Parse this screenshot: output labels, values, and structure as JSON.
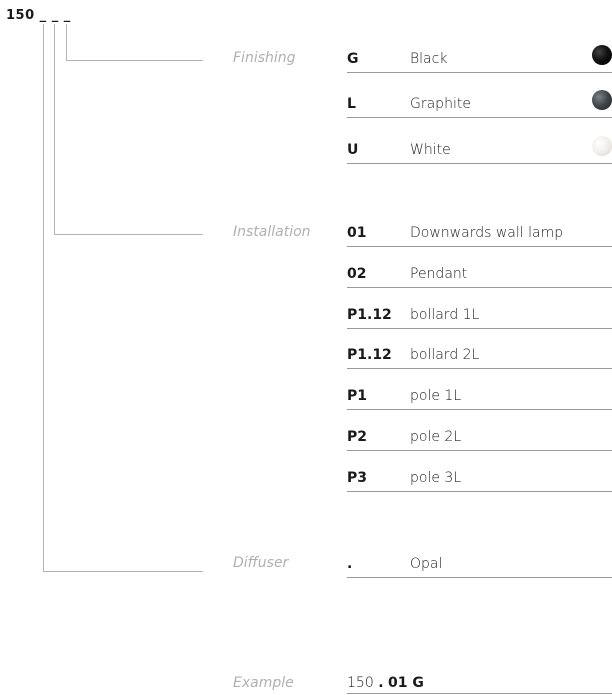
{
  "code_header": "150 _ _ _",
  "finishing": {
    "label": "Finishing",
    "options": [
      {
        "code": "G",
        "name": "Black",
        "swatch": "black-icon",
        "color": "#111111"
      },
      {
        "code": "L",
        "name": "Graphite",
        "swatch": "graphite-icon",
        "color": "#3e4446"
      },
      {
        "code": "U",
        "name": "White",
        "swatch": "white-icon",
        "color": "#f1ece8"
      }
    ]
  },
  "installation": {
    "label": "Installation",
    "options": [
      {
        "code": "01",
        "name": "Downwards wall lamp"
      },
      {
        "code": "02",
        "name": "Pendant"
      },
      {
        "code": "P1.12",
        "name": "bollard 1L"
      },
      {
        "code": "P1.12",
        "name": "bollard 2L"
      },
      {
        "code": "P1",
        "name": "pole 1L"
      },
      {
        "code": "P2",
        "name": "pole 2L"
      },
      {
        "code": "P3",
        "name": "pole 3L"
      }
    ]
  },
  "diffuser": {
    "label": "Diffuser",
    "options": [
      {
        "code": ".",
        "name": "Opal"
      }
    ]
  },
  "example": {
    "label": "Example",
    "base": "150",
    "sep": ".",
    "rest": "01 G"
  }
}
